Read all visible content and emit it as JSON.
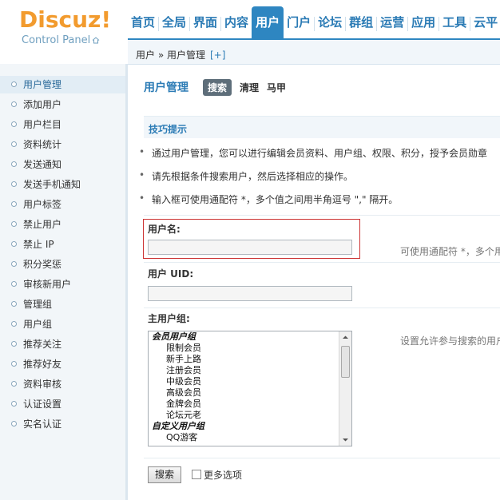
{
  "logo": {
    "word": "Discuz!",
    "sub": "Control Panel"
  },
  "nav": {
    "tabs": [
      {
        "label": "首页"
      },
      {
        "label": "全局"
      },
      {
        "label": "界面"
      },
      {
        "label": "内容"
      },
      {
        "label": "用户",
        "active": true
      },
      {
        "label": "门户"
      },
      {
        "label": "论坛"
      },
      {
        "label": "群组"
      },
      {
        "label": "运营"
      },
      {
        "label": "应用"
      },
      {
        "label": "工具"
      },
      {
        "label": "云平"
      }
    ]
  },
  "breadcrumb": {
    "text": "用户 » 用户管理",
    "plus": "[+]"
  },
  "sidebar": {
    "items": [
      {
        "label": "用户管理",
        "active": true
      },
      {
        "label": "添加用户"
      },
      {
        "label": "用户栏目"
      },
      {
        "label": "资料统计"
      },
      {
        "label": "发送通知"
      },
      {
        "label": "发送手机通知"
      },
      {
        "label": "用户标签"
      },
      {
        "label": "禁止用户"
      },
      {
        "label": "禁止 IP"
      },
      {
        "label": "积分奖惩"
      },
      {
        "label": "审核新用户"
      },
      {
        "label": "管理组"
      },
      {
        "label": "用户组"
      },
      {
        "label": "推荐关注"
      },
      {
        "label": "推荐好友"
      },
      {
        "label": "资料审核"
      },
      {
        "label": "认证设置"
      },
      {
        "label": "实名认证"
      }
    ]
  },
  "main": {
    "title": "用户管理",
    "subtabs": [
      {
        "label": "搜索",
        "active": true
      },
      {
        "label": "清理"
      },
      {
        "label": "马甲"
      }
    ],
    "tips": {
      "title": "技巧提示",
      "items": [
        "通过用户管理，您可以进行编辑会员资料、用户组、权限、积分，授予会员勋章",
        "请先根据条件搜索用户，然后选择相应的操作。",
        "输入框可使用通配符 *，多个值之间用半角逗号 \",\" 隔开。"
      ]
    },
    "username": {
      "label": "用户名:",
      "value": "",
      "hint": "可使用通配符 *，多个用"
    },
    "uid": {
      "label": "用户 UID:",
      "value": ""
    },
    "groups": {
      "label": "主用户组:",
      "hint": "设置允许参与搜索的用户",
      "options": [
        {
          "label": "会员用户组",
          "group": true
        },
        {
          "label": "限制会员"
        },
        {
          "label": "新手上路"
        },
        {
          "label": "注册会员"
        },
        {
          "label": "中级会员"
        },
        {
          "label": "高级会员"
        },
        {
          "label": "金牌会员"
        },
        {
          "label": "论坛元老"
        },
        {
          "label": "自定义用户组",
          "group": true
        },
        {
          "label": "QQ游客"
        }
      ]
    },
    "search_button": "搜索",
    "more_options": {
      "label": "更多选项",
      "checked": false
    }
  }
}
